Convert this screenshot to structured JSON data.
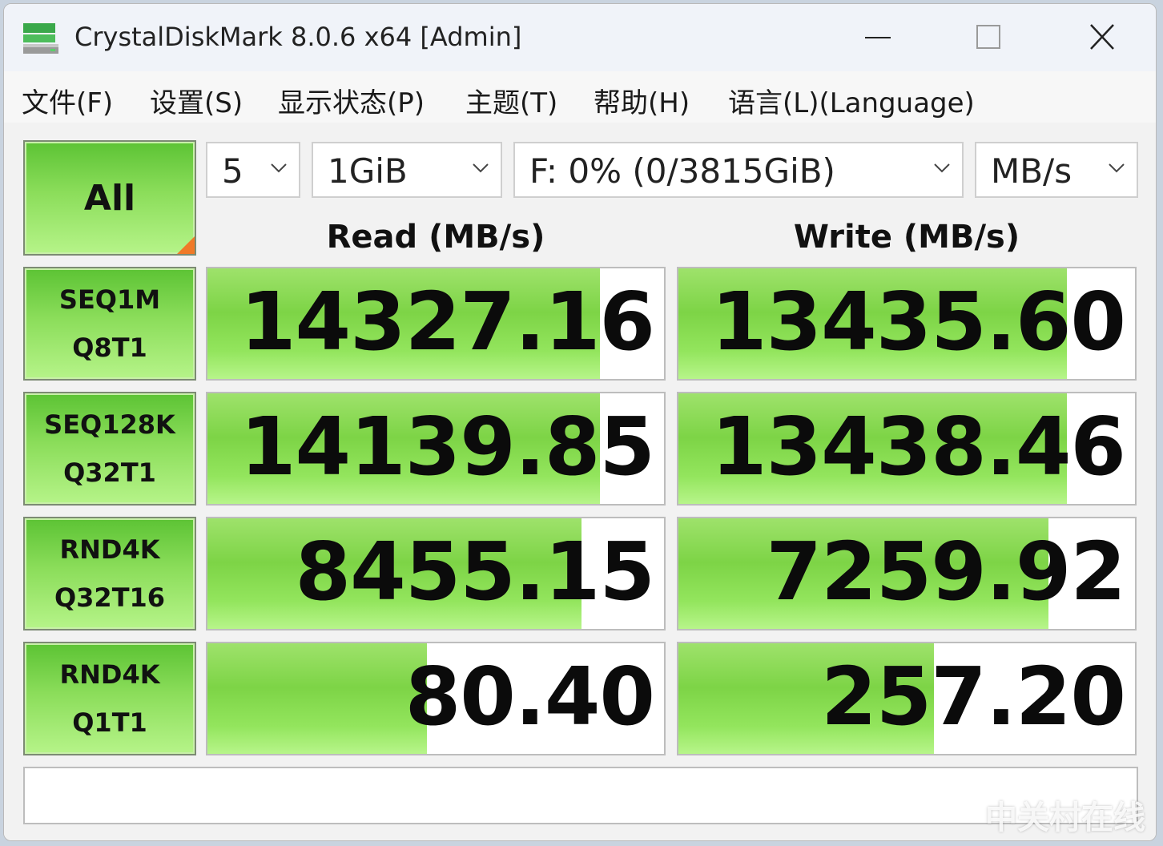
{
  "window": {
    "title": "CrystalDiskMark 8.0.6 x64 [Admin]"
  },
  "menu": {
    "items": [
      "文件(F)",
      "设置(S)",
      "显示状态(P)",
      "主题(T)",
      "帮助(H)",
      "语言(L)(Language)"
    ]
  },
  "controls": {
    "all_label": "All",
    "count": "5",
    "size": "1GiB",
    "drive": "F: 0% (0/3815GiB)",
    "unit": "MB/s"
  },
  "columns": {
    "read": "Read (MB/s)",
    "write": "Write (MB/s)"
  },
  "tests": [
    {
      "line1": "SEQ1M",
      "line2": "Q8T1",
      "read": "14327.16",
      "write": "13435.60",
      "read_fill": 0.86,
      "write_fill": 0.85
    },
    {
      "line1": "SEQ128K",
      "line2": "Q32T1",
      "read": "14139.85",
      "write": "13438.46",
      "read_fill": 0.86,
      "write_fill": 0.85
    },
    {
      "line1": "RND4K",
      "line2": "Q32T16",
      "read": "8455.15",
      "write": "7259.92",
      "read_fill": 0.82,
      "write_fill": 0.81
    },
    {
      "line1": "RND4K",
      "line2": "Q1T1",
      "read": "80.40",
      "write": "257.20",
      "read_fill": 0.48,
      "write_fill": 0.56
    }
  ],
  "comment": "",
  "watermark": "中关村在线",
  "colors": {
    "accent_green": "#7dd446",
    "corner_orange": "#f07a28"
  }
}
